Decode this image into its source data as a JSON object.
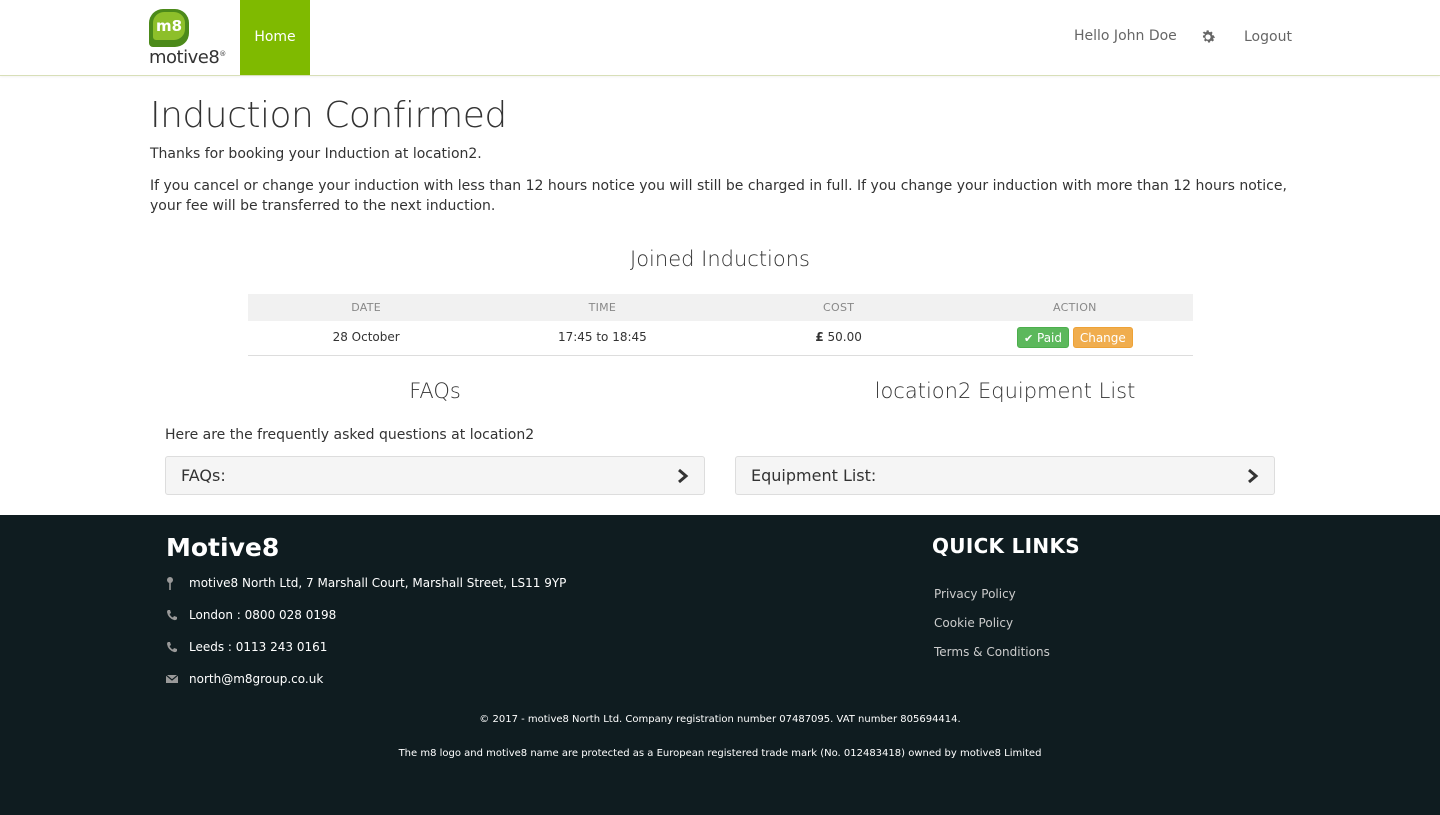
{
  "nav": {
    "brand_badge": "m8",
    "brand_word": "motive8",
    "home_label": "Home",
    "greeting": "Hello John Doe",
    "logout_label": "Logout"
  },
  "page": {
    "title": "Induction Confirmed",
    "thanks_text": "Thanks for booking your Induction at location2.",
    "policy_text": "If you cancel or change your induction with less than 12 hours notice you will still be charged in full. If you change your induction with more than 12 hours notice, your fee will be transferred to the next induction."
  },
  "inductions": {
    "title": "Joined Inductions",
    "columns": [
      "DATE",
      "TIME",
      "COST",
      "ACTION"
    ],
    "rows": [
      {
        "date": "28 October",
        "time": "17:45 to 18:45",
        "cost_symbol": "£",
        "cost": "50.00",
        "paid_label": "Paid",
        "change_label": "Change"
      }
    ]
  },
  "faqs": {
    "title": "FAQs",
    "intro": "Here are the frequently asked questions at location2",
    "panel_label": "FAQs:"
  },
  "equipment": {
    "title": "location2 Equipment List",
    "panel_label": "Equipment List:"
  },
  "footer": {
    "brand": "Motive8",
    "address": "motive8 North Ltd, 7 Marshall Court, Marshall Street, LS11 9YP",
    "london_phone": "London : 0800 028 0198",
    "leeds_phone": "Leeds : 0113 243 0161",
    "email": "north@m8group.co.uk",
    "quick_links_title": "QUICK LINKS",
    "links": [
      "Privacy Policy",
      "Cookie Policy",
      "Terms & Conditions"
    ],
    "copyright": "© 2017 - motive8 North Ltd. Company registration number 07487095. VAT number 805694414.",
    "trademark": "The m8 logo and motive8 name are protected as a European registered trade mark (No. 012483418) owned by motive8 Limited"
  },
  "colors": {
    "accent": "#7fba00",
    "footer_bg": "#0f1c20",
    "paid": "#5cb85c",
    "change": "#f0ad4e"
  }
}
